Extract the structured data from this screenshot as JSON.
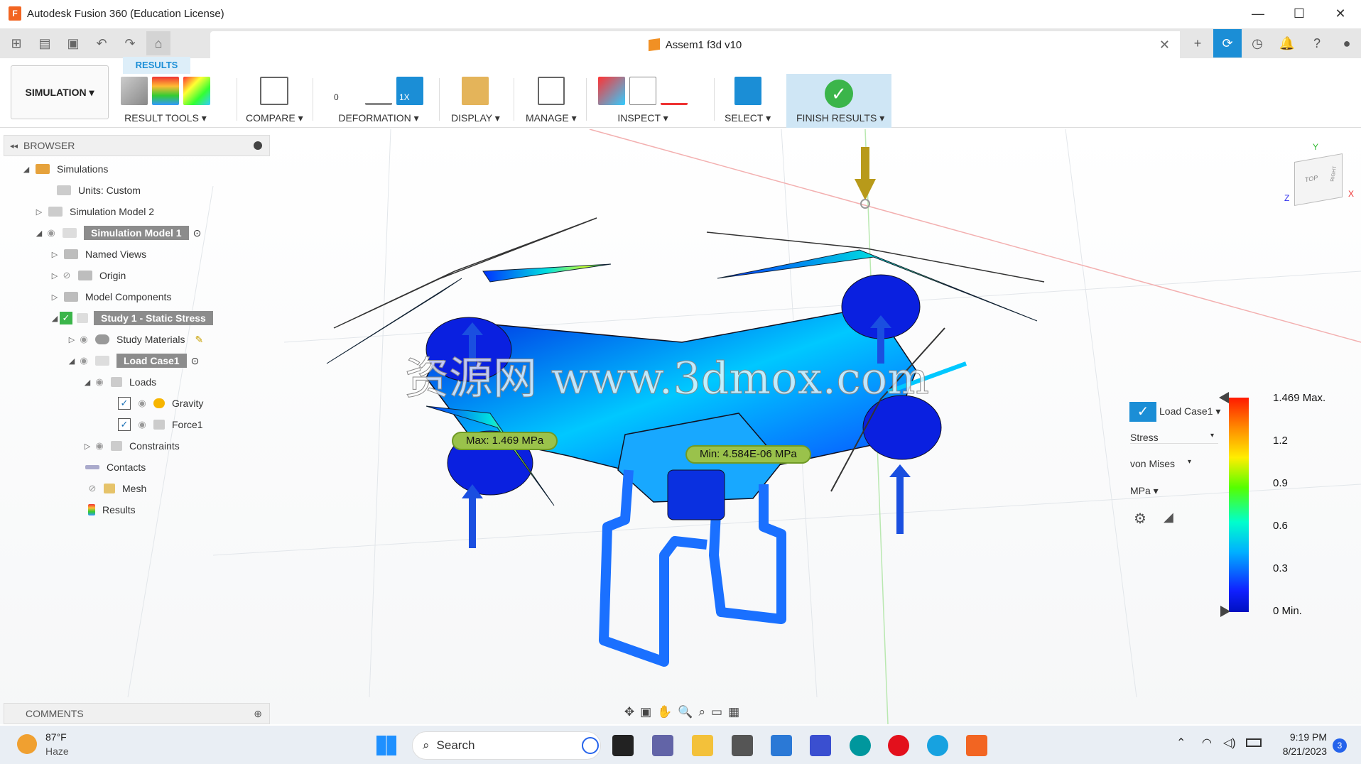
{
  "window": {
    "title": "Autodesk Fusion 360 (Education License)",
    "min": "—",
    "max": "☐",
    "close": "✕"
  },
  "document": {
    "tab_title": "Assem1 f3d v10",
    "close": "✕"
  },
  "qat": {
    "grid": "⊞",
    "file": "▤",
    "save": "▣",
    "undo": "↶",
    "redo": "↷",
    "home": "⌂"
  },
  "qat_right": {
    "new": "+",
    "extensions": "⟳",
    "job_status": "◷",
    "notifications": "🔔",
    "help": "?",
    "profile": "●"
  },
  "ribbon": {
    "workspace": "SIMULATION ▾",
    "active_tab": "RESULTS",
    "groups": {
      "result_tools": "RESULT TOOLS ▾",
      "compare": "COMPARE ▾",
      "deformation": "DEFORMATION ▾",
      "display": "DISPLAY ▾",
      "manage": "MANAGE ▾",
      "inspect": "INSPECT ▾",
      "select": "SELECT ▾",
      "finish": "FINISH RESULTS ▾"
    },
    "deformation_zero": "0",
    "deformation_scale": "1X"
  },
  "browser": {
    "title": "BROWSER",
    "items": [
      {
        "label": "Simulations"
      },
      {
        "label": "Units: Custom"
      },
      {
        "label": "Simulation Model 2"
      },
      {
        "label": "Simulation Model 1"
      },
      {
        "label": "Named Views"
      },
      {
        "label": "Origin"
      },
      {
        "label": "Model Components"
      },
      {
        "label": "Study 1 - Static Stress"
      },
      {
        "label": "Study Materials"
      },
      {
        "label": "Load Case1"
      },
      {
        "label": "Loads"
      },
      {
        "label": "Gravity"
      },
      {
        "label": "Force1"
      },
      {
        "label": "Constraints"
      },
      {
        "label": "Contacts"
      },
      {
        "label": "Mesh"
      },
      {
        "label": "Results"
      }
    ]
  },
  "comments": {
    "title": "COMMENTS"
  },
  "viewport": {
    "max_callout": "Max: 1.469 MPa",
    "min_callout": "Min: 4.584E-06 MPa",
    "watermark": "资源网 www.3dmox.com",
    "viewcube_top": "TOP",
    "viewcube_right": "RIGHT",
    "axis_x": "X",
    "axis_y": "Y",
    "axis_z": "Z"
  },
  "legend": {
    "load_case": "Load Case1 ▾",
    "result_type": "Stress",
    "component": "von Mises",
    "unit": "MPa ▾",
    "ticks": [
      "1.469 Max.",
      "1.2",
      "0.9",
      "0.6",
      "0.3",
      "0 Min."
    ],
    "colors": [
      "#ff1a00",
      "#ffee00",
      "#55ff00",
      "#00ffcc",
      "#00b0ff",
      "#1020ff"
    ]
  },
  "navbar": {
    "orbit": "✥",
    "look": "▣",
    "pan": "✋",
    "zoom": "🔍",
    "fit": "⌕",
    "display": "▭",
    "grid": "▦"
  },
  "taskbar": {
    "weather_temp": "87°F",
    "weather_desc": "Haze",
    "search_label": "Search",
    "time": "9:19 PM",
    "date": "8/21/2023",
    "notif_count": "3"
  }
}
